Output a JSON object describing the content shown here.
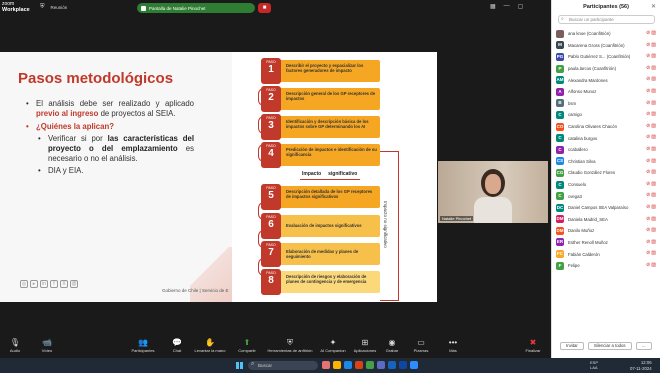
{
  "app": {
    "brand_line1": "zoom",
    "brand_line2": "Workplace",
    "meeting_label": "Reunión"
  },
  "share_banner": {
    "label": "Pantalla de Natalie Pinochet"
  },
  "slide": {
    "title": "Pasos metodológicos",
    "b1_pre": "El análisis debe ser realizado y aplicado ",
    "b1_red": "previo al ingreso",
    "b1_post": " de proyectos al SEIA.",
    "question": "¿Quiénes la aplican?",
    "sub1_pre": "Verificar si por ",
    "sub1_bold": "las características del proyecto o del emplazamiento",
    "sub1_post": " es necesario o no el análisis.",
    "sub2": "DIA y EIA.",
    "footer": "Gobierno de Chile | Servicio de E",
    "step_word": "PASO",
    "impacto_label": "Impacto",
    "significativo_label": "significativo",
    "vertical_label": "Impacto no significativo",
    "steps": [
      {
        "n": "1",
        "text": "Describir el proyecto y espacializar los factores generadores de impacto"
      },
      {
        "n": "2",
        "text": "Descripción general de los GP receptores de impactos"
      },
      {
        "n": "3",
        "text": "Identificación y descripción básica de los impactos sobre GP determinando los AI"
      },
      {
        "n": "4",
        "text": "Predicción de impactos e identificación de su significancia"
      },
      {
        "n": "5",
        "text": "Descripción detallada de los GP receptores de impactos significativos"
      },
      {
        "n": "6",
        "text": "Evaluación de impactos significativos"
      },
      {
        "n": "7",
        "text": "Elaboración de medidas y planes de seguimiento"
      },
      {
        "n": "8",
        "text": "Descripción de riesgos y elaboración de planes de contingencia y de emergencia"
      }
    ]
  },
  "webcam": {
    "name": "Natalie Pinochet"
  },
  "panel": {
    "title": "Participantes (56)",
    "search_placeholder": "Buscar un participante",
    "invite": "Invitar",
    "mute_all": "Silenciar a todos",
    "participants": [
      {
        "initial": "",
        "name": "ana knoe (Coanfitrión)",
        "color": "#7b5e57"
      },
      {
        "initial": "M",
        "name": "Macarena Gross (Coanfitrión)",
        "color": "#37474f"
      },
      {
        "initial": "PG",
        "name": "Pablo Gutiérrez S... (Coanfitrión)",
        "color": "#3949ab"
      },
      {
        "initial": "P",
        "name": "paola.larcos (Coanfitrión)",
        "color": "#43a047"
      },
      {
        "initial": "AM",
        "name": "Alexandra Mardones",
        "color": "#00897b"
      },
      {
        "initial": "A",
        "name": "Alfonso Munoz",
        "color": "#8e24aa"
      },
      {
        "initial": "B",
        "name": "bsm",
        "color": "#546e7a"
      },
      {
        "initial": "C",
        "name": "camigo",
        "color": "#00897b"
      },
      {
        "initial": "CO",
        "name": "Carolina Olivares Chacón",
        "color": "#f4511e"
      },
      {
        "initial": "C",
        "name": "catalina burgos",
        "color": "#00897b"
      },
      {
        "initial": "C",
        "name": "ccaballero",
        "color": "#8e24aa"
      },
      {
        "initial": "CS",
        "name": "Christian Silva",
        "color": "#1e88e5"
      },
      {
        "initial": "CG",
        "name": "Claudio González Flores",
        "color": "#43a047"
      },
      {
        "initial": "C",
        "name": "Consuelo",
        "color": "#00897b"
      },
      {
        "initial": "C",
        "name": "cvega3",
        "color": "#43a047"
      },
      {
        "initial": "DC",
        "name": "Daniel Campos SEA Valparaíso",
        "color": "#00897b"
      },
      {
        "initial": "DM",
        "name": "Daniela Madrid_SEA",
        "color": "#d81b60"
      },
      {
        "initial": "DM",
        "name": "Danilo Muñoz",
        "color": "#f4511e"
      },
      {
        "initial": "ER",
        "name": "Esther Renoll Muñoz",
        "color": "#8e24aa"
      },
      {
        "initial": "FC",
        "name": "Fabián Calderón",
        "color": "#f9a825"
      },
      {
        "initial": "F",
        "name": "Felipe",
        "color": "#43a047"
      }
    ]
  },
  "toolbar": {
    "audio": "Audio",
    "video": "Vídeo",
    "participants": "Participantes",
    "participants_count": "56",
    "chat": "Chat",
    "raise_hand": "Levantar la mano",
    "share": "Compartir",
    "whiteboard": "Herramientas de anfitrión",
    "ai": "AI Companion",
    "apps": "Aplicaciones",
    "record": "Grabar",
    "whiteboards": "Pizarras",
    "more": "Más",
    "end": "Finalizar"
  },
  "taskbar": {
    "search": "Buscar",
    "lang1": "ESP",
    "lang2": "LAA",
    "time": "12:06",
    "date": "07-11-2024"
  }
}
